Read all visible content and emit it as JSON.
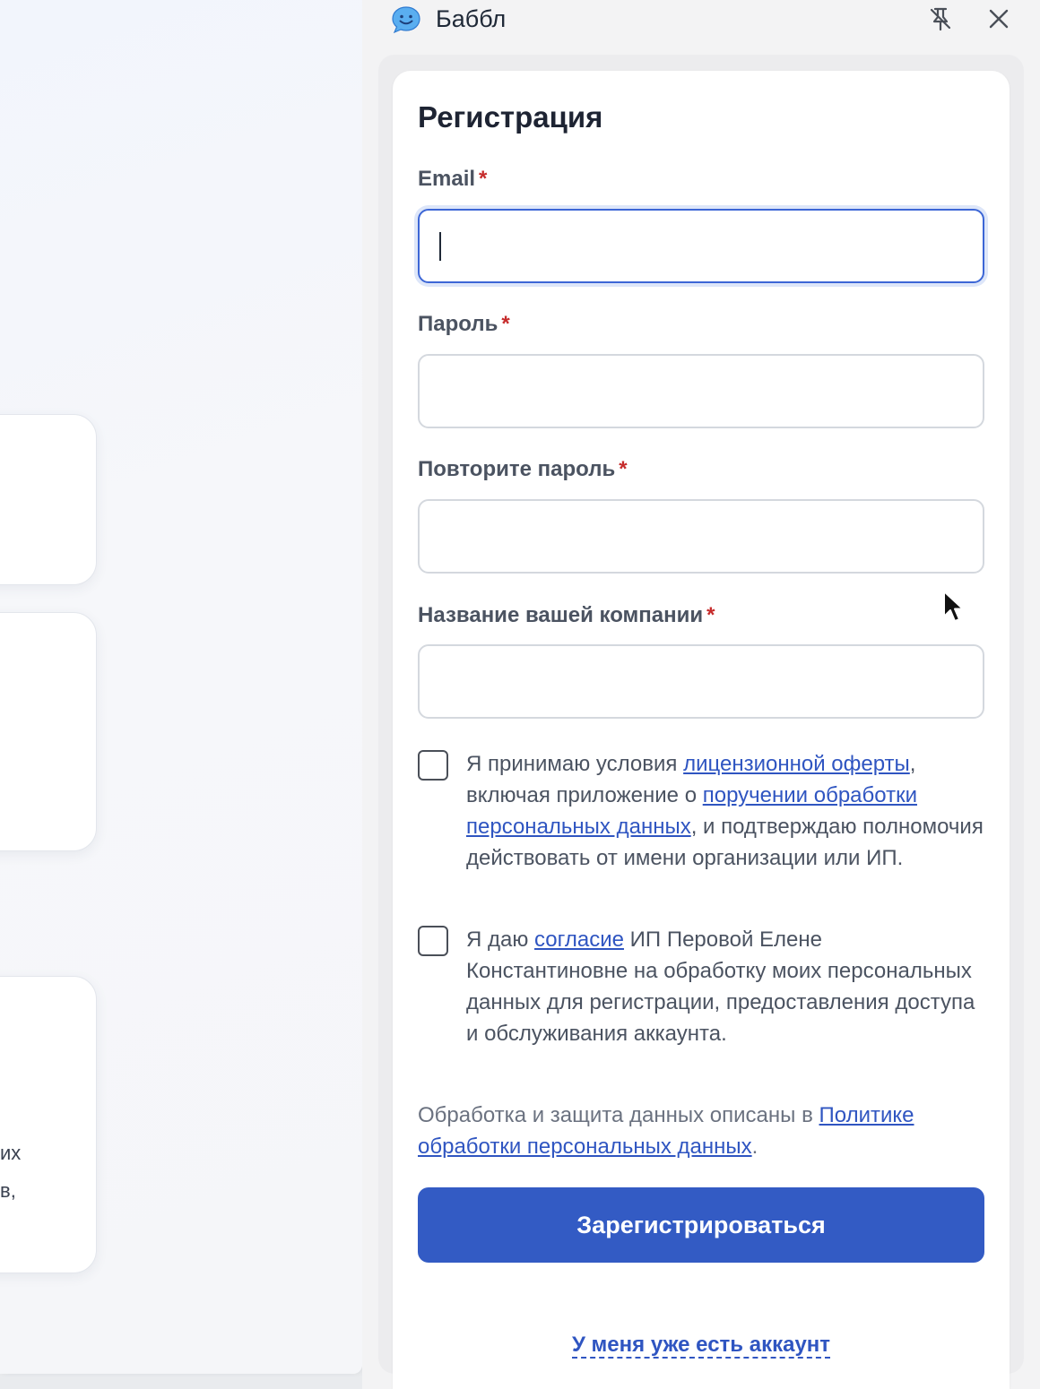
{
  "background_page": {
    "fragment_line_1": "их",
    "fragment_line_2": "в,"
  },
  "panel": {
    "app_title": "Баббл",
    "icons": {
      "logo": "chat-bubble-smile-icon",
      "unpin": "pin-off-icon",
      "close": "close-icon"
    }
  },
  "form": {
    "title": "Регистрация",
    "required_mark": "*",
    "fields": {
      "email": {
        "label": "Email",
        "value": "",
        "placeholder": ""
      },
      "password": {
        "label": "Пароль",
        "value": "",
        "placeholder": ""
      },
      "password_repeat": {
        "label": "Повторите пароль",
        "value": "",
        "placeholder": ""
      },
      "company": {
        "label": "Название вашей компании",
        "value": "",
        "placeholder": ""
      }
    },
    "consent_offer": {
      "checked": false,
      "text_1": "Я принимаю условия ",
      "link_1": "лицензионной оферты",
      "text_2": ", включая приложение о ",
      "link_2": "поручении обработки персональных данных",
      "text_3": ", и подтверждаю полномочия действовать от имени организации или ИП."
    },
    "consent_personal_data": {
      "checked": false,
      "text_1": "Я даю ",
      "link_1": "согласие",
      "text_2": " ИП Перовой Елене Константиновне на обработку моих персональных данных для регистрации, предоставления доступа и обслуживания аккаунта."
    },
    "policy_note": {
      "text_1": "Обработка и защита данных описаны в ",
      "link": "Политике обработки персональных данных",
      "text_2": "."
    },
    "submit_label": "Зарегистрироваться",
    "login_link": "У меня уже есть аккаунт"
  },
  "colors": {
    "primary": "#335bc4",
    "link": "#2f55c1",
    "required": "#c62b2b",
    "focus_border": "#3c66d6"
  }
}
